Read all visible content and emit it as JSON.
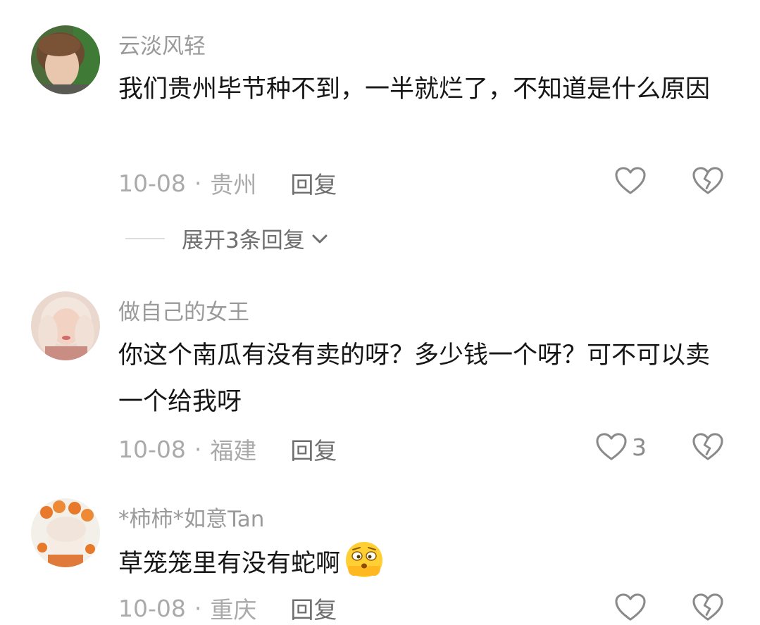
{
  "comments": [
    {
      "username": "云淡风轻",
      "text": "我们贵州毕节种不到，一半就烂了，不知道是什么原因",
      "date": "10-08",
      "separator": "·",
      "location": "贵州",
      "reply_label": "回复",
      "like_count": ""
    },
    {
      "username": "做自己的女王",
      "text": "你这个南瓜有没有卖的呀？多少钱一个呀？可不可以卖一个给我呀",
      "date": "10-08",
      "separator": "·",
      "location": "福建",
      "reply_label": "回复",
      "like_count": "3"
    },
    {
      "username": "*柿柿*如意Tan",
      "text": "草笼笼里有没有蛇啊",
      "date": "10-08",
      "separator": "·",
      "location": "重庆",
      "reply_label": "回复",
      "like_count": ""
    }
  ],
  "expand_replies": {
    "label": "展开3条回复"
  },
  "icons": {
    "like": "heart-outline-icon",
    "dislike": "broken-heart-icon",
    "expand": "chevron-down-icon",
    "emoji": "dizzy-face-emoji"
  },
  "colors": {
    "username": "#9a9a9a",
    "text": "#161616",
    "meta": "#aaaaaa",
    "reply": "#6e6e6e",
    "icon": "#8a8a8a"
  }
}
